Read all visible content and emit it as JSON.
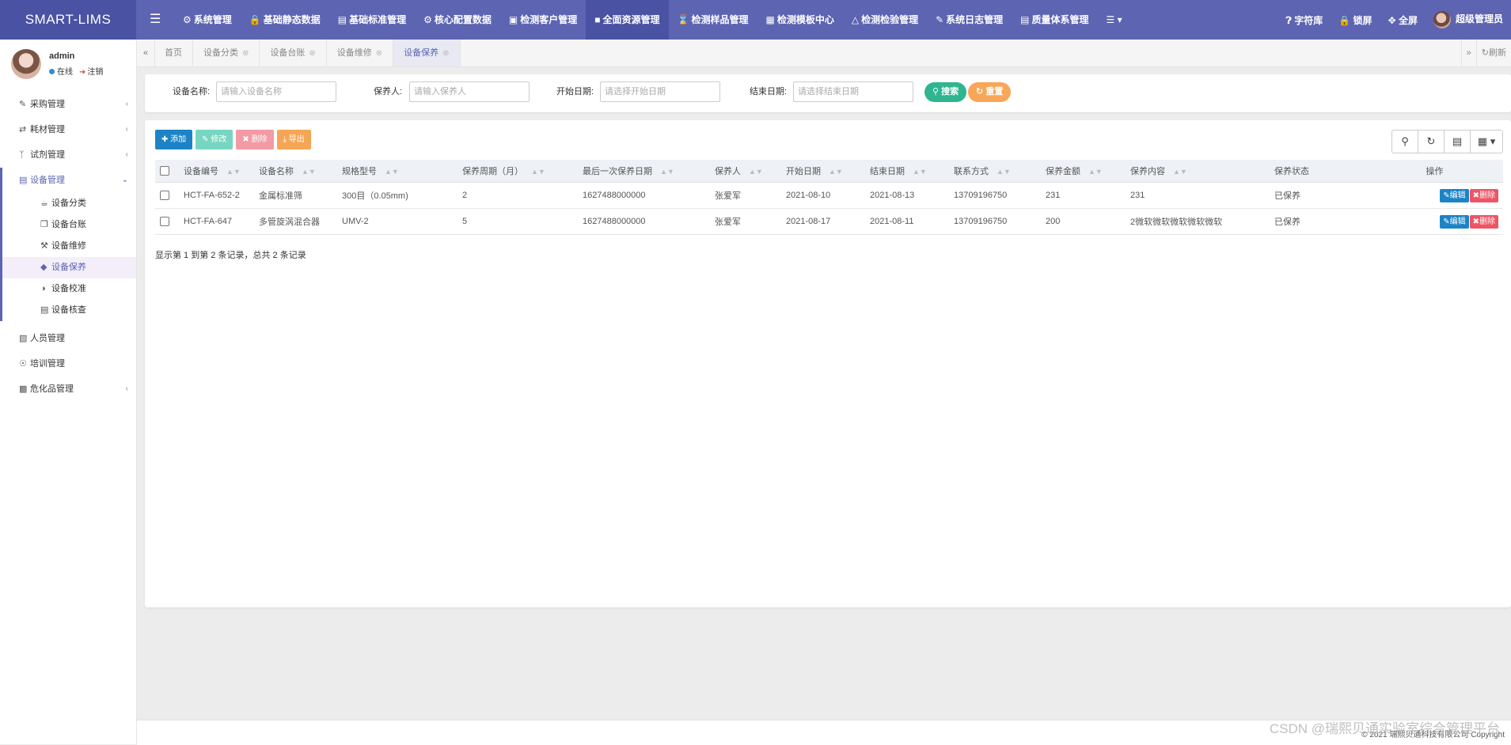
{
  "app": {
    "brand": "SMART-LIMS"
  },
  "topnav": {
    "menu_icon": "hamburger-icon",
    "items": [
      {
        "label": "系统管理",
        "icon": "gear-icon"
      },
      {
        "label": "基础静态数据",
        "icon": "lock-icon"
      },
      {
        "label": "基础标准管理",
        "icon": "book-icon"
      },
      {
        "label": "核心配置数据",
        "icon": "gear-icon"
      },
      {
        "label": "检测客户管理",
        "icon": "id-card-icon"
      },
      {
        "label": "全面资源管理",
        "icon": "folder-icon"
      },
      {
        "label": "检测样品管理",
        "icon": "hourglass-icon"
      },
      {
        "label": "检测模板中心",
        "icon": "calendar-icon"
      },
      {
        "label": "检测检验管理",
        "icon": "flask-icon"
      },
      {
        "label": "系统日志管理",
        "icon": "edit-icon"
      },
      {
        "label": "质量体系管理",
        "icon": "book-icon"
      }
    ],
    "more_icon": "list-dropdown-icon",
    "right": {
      "font_library": "字符库",
      "lock_screen": "锁屏",
      "fullscreen": "全屏",
      "user": "超级管理员"
    }
  },
  "sidebar": {
    "user": {
      "name": "admin",
      "status": "在线",
      "logout": "注销"
    },
    "menu": [
      {
        "label": "采购管理",
        "icon": "edit-icon"
      },
      {
        "label": "耗材管理",
        "icon": "exchange-icon"
      },
      {
        "label": "试剂管理",
        "icon": "branch-icon"
      },
      {
        "label": "设备管理",
        "icon": "book-icon"
      }
    ],
    "submenu": [
      {
        "label": "设备分类",
        "icon": "coffee-icon"
      },
      {
        "label": "设备台账",
        "icon": "clone-icon"
      },
      {
        "label": "设备维修",
        "icon": "wrench-icon"
      },
      {
        "label": "设备保养",
        "icon": "diamond-icon"
      },
      {
        "label": "设备校准",
        "icon": "half-circle-icon"
      },
      {
        "label": "设备核查",
        "icon": "book-icon"
      }
    ],
    "menu_after": [
      {
        "label": "人员管理",
        "icon": "folder-open-icon"
      },
      {
        "label": "培训管理",
        "icon": "user-circle-icon"
      },
      {
        "label": "危化品管理",
        "icon": "file-image-icon"
      }
    ]
  },
  "tabs": {
    "items": [
      {
        "label": "首页"
      },
      {
        "label": "设备分类"
      },
      {
        "label": "设备台账"
      },
      {
        "label": "设备维修"
      },
      {
        "label": "设备保养"
      }
    ],
    "refresh": "刷新"
  },
  "search": {
    "name_label": "设备名称:",
    "name_placeholder": "请输入设备名称",
    "keeper_label": "保养人:",
    "keeper_placeholder": "请输入保养人",
    "start_label": "开始日期:",
    "start_placeholder": "请选择开始日期",
    "end_label": "结束日期:",
    "end_placeholder": "请选择结束日期",
    "search_button": "搜索",
    "reset_button": "重置"
  },
  "toolbar": {
    "add": "添加",
    "edit": "修改",
    "delete": "删除",
    "export": "导出"
  },
  "table": {
    "columns": [
      "设备编号",
      "设备名称",
      "规格型号",
      "保养周期（月）",
      "最后一次保养日期",
      "保养人",
      "开始日期",
      "结束日期",
      "联系方式",
      "保养金额",
      "保养内容",
      "保养状态",
      "操作"
    ],
    "rows": [
      [
        "HCT-FA-652-2",
        "金属标准筛",
        "300目（0.05mm)",
        "2",
        "1627488000000",
        "张爱军",
        "2021-08-10",
        "2021-08-13",
        "13709196750",
        "231",
        "231",
        "已保养"
      ],
      [
        "HCT-FA-647",
        "多管旋涡混合器",
        "UMV-2",
        "5",
        "1627488000000",
        "张爱军",
        "2021-08-17",
        "2021-08-11",
        "13709196750",
        "200",
        "2微软微软微软微软微软",
        "已保养"
      ]
    ],
    "edit_label": "编辑",
    "delete_label": "删除",
    "page_info": "显示第 1 到第 2 条记录，总共 2 条记录"
  },
  "footer": {
    "copyright": "© 2021 瑞熙贝通科技有限公司 Copyright"
  },
  "watermark": "CSDN @瑞熙贝通实验室综合管理平台",
  "colors": {
    "primary": "#5d64b2",
    "add": "#1c84c6",
    "edit": "#77d6c1",
    "delete": "#f29aa5",
    "export": "#f5a655",
    "search": "#2fb58f",
    "reset": "#f8a657"
  }
}
